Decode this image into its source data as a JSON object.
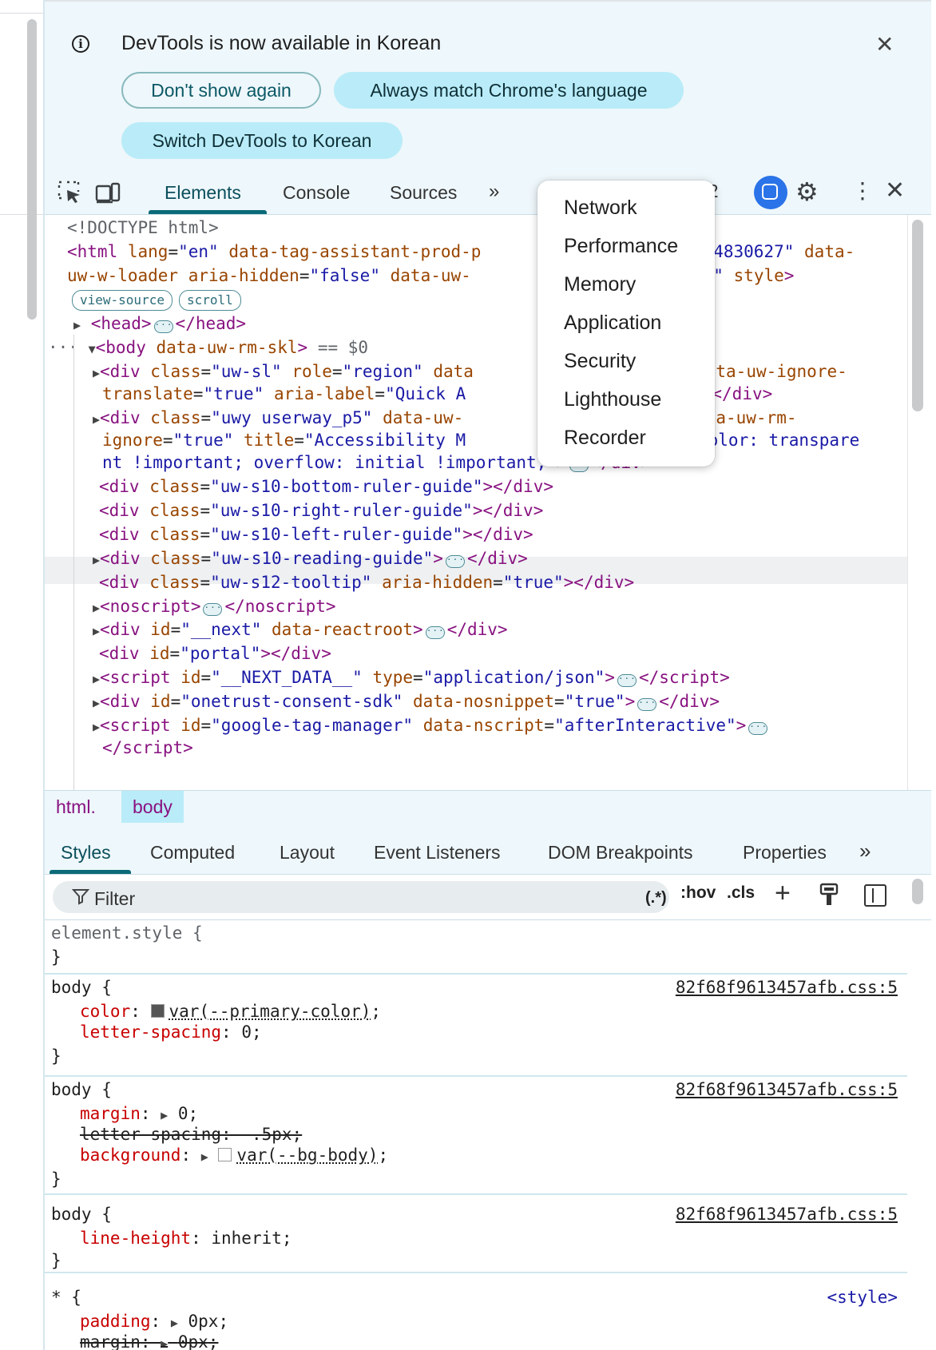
{
  "infobar": {
    "message": "DevTools is now available in Korean",
    "dont_show": "Don't show again",
    "always_match": "Always match Chrome's language",
    "switch": "Switch DevTools to Korean"
  },
  "toolbar": {
    "tabs": [
      "Elements",
      "Console",
      "Sources"
    ],
    "more": "»",
    "issues_count": "32"
  },
  "overflow_menu": {
    "items": [
      "Network",
      "Performance",
      "Memory",
      "Application",
      "Security",
      "Lighthouse",
      "Recorder"
    ]
  },
  "dom": {
    "doctype": "<!DOCTYPE html>",
    "chips": [
      "view-source",
      "scroll"
    ],
    "selected_suffix": "== $0"
  },
  "breadcrumb": [
    "html.",
    "body"
  ],
  "sidebar": {
    "tabs": [
      "Styles",
      "Computed",
      "Layout",
      "Event Listeners",
      "DOM Breakpoints",
      "Properties"
    ],
    "more": "»"
  },
  "filter": {
    "placeholder": "Filter",
    "regex": "(.*)",
    "hov": ":hov",
    "cls": ".cls"
  },
  "styles": {
    "element_style": "element.style {",
    "close": "}",
    "source": "82f68f9613457afb.css:5",
    "style_source": "<style>",
    "rules": [
      {
        "selector": "body {",
        "props": [
          [
            "color",
            "var(--primary-color)"
          ],
          [
            "letter-spacing",
            "0"
          ]
        ]
      },
      {
        "selector": "body {",
        "props": [
          [
            "margin",
            "0"
          ],
          [
            "letter-spacing",
            ".5px"
          ],
          [
            "background",
            "var(--bg-body)"
          ]
        ]
      },
      {
        "selector": "body {",
        "props": [
          [
            "line-height",
            "inherit"
          ]
        ]
      },
      {
        "selector": "* {",
        "props": [
          [
            "padding",
            "0px"
          ],
          [
            "margin",
            "0px"
          ]
        ]
      }
    ]
  },
  "colors": {
    "accent": "#0b6a78",
    "infobar_bg": "#eef7fb",
    "pill": "#b9ecf8",
    "tag": "#881280",
    "attr": "#994500",
    "value": "#1a1aa6",
    "prop": "#c80000"
  }
}
